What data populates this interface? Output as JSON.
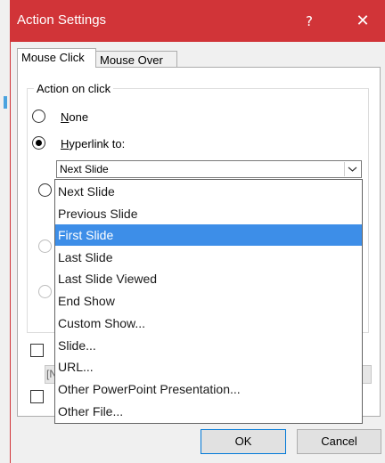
{
  "window": {
    "title": "Action Settings",
    "help": "?",
    "close": "✕"
  },
  "tabs": [
    {
      "label": "Mouse Click"
    },
    {
      "label": "Mouse Over"
    }
  ],
  "group": {
    "legend": "Action on click"
  },
  "options": {
    "none": {
      "label_u": "N",
      "label_rest": "one"
    },
    "hyperlink": {
      "label_u": "H",
      "label_rest": "yperlink to:"
    }
  },
  "hyperlink_select": {
    "value": "Next Slide"
  },
  "dropdown": {
    "items": [
      "Next Slide",
      "Previous Slide",
      "First Slide",
      "Last Slide",
      "Last Slide Viewed",
      "End Show",
      "Custom Show...",
      "Slide...",
      "URL...",
      "Other PowerPoint Presentation...",
      "Other File..."
    ],
    "selected_index": 2
  },
  "hidden_field_text": "[N",
  "buttons": {
    "ok": "OK",
    "cancel": "Cancel"
  },
  "colors": {
    "titlebar": "#d13438",
    "selection": "#3d8ee8"
  }
}
